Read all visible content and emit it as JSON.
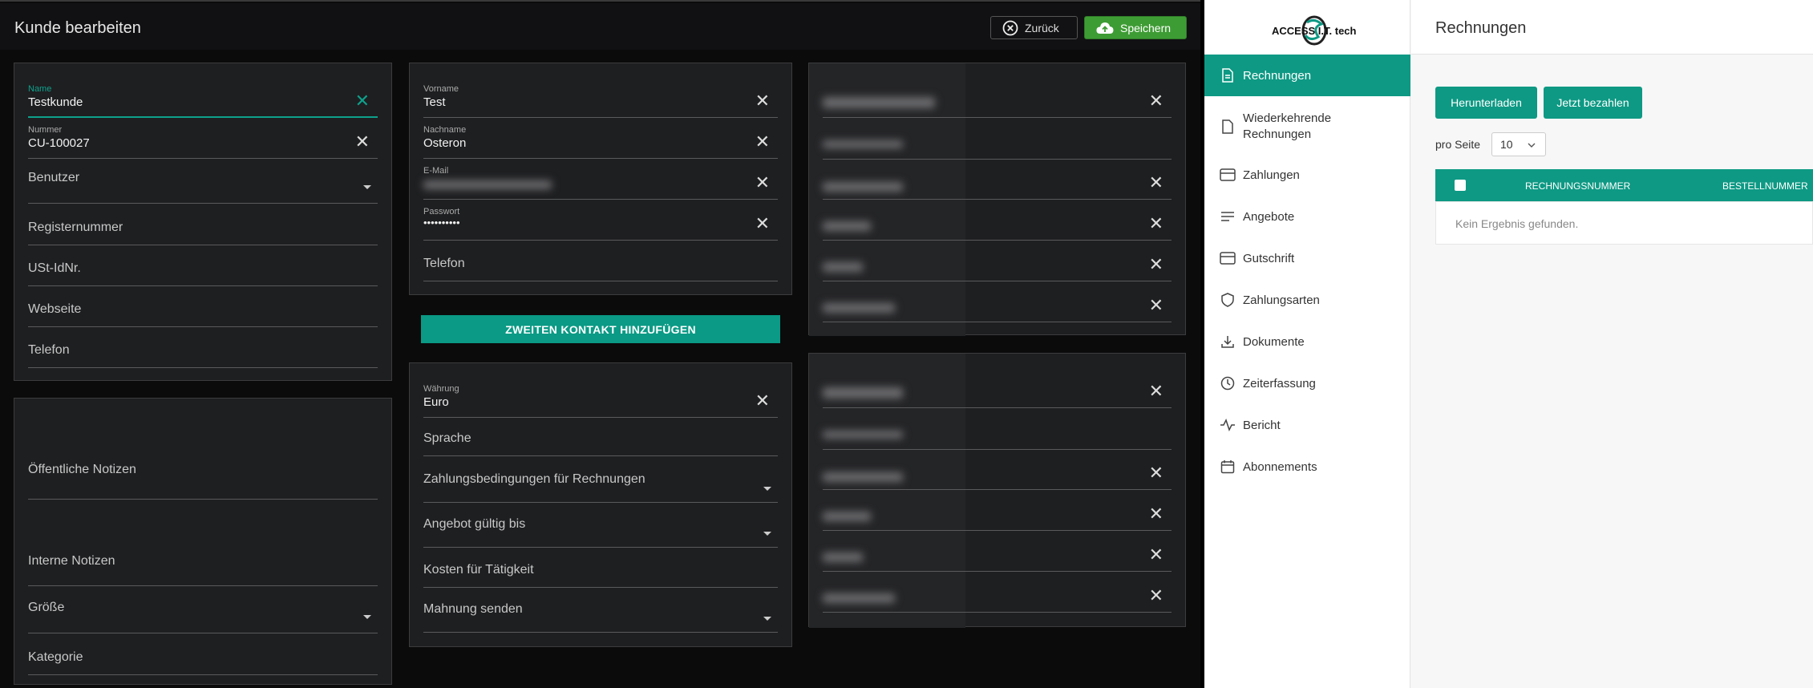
{
  "left": {
    "title": "Kunde bearbeiten",
    "back_label": "Zurück",
    "save_label": "Speichern",
    "card1": {
      "name_label": "Name",
      "name_value": "Testkunde",
      "number_label": "Nummer",
      "number_value": "CU-100027",
      "user_placeholder": "Benutzer",
      "registry_placeholder": "Registernummer",
      "vat_placeholder": "USt-IdNr.",
      "website_placeholder": "Webseite",
      "phone_placeholder": "Telefon"
    },
    "card2": {
      "public_notes": "Öffentliche Notizen",
      "internal_notes": "Interne Notizen",
      "size_placeholder": "Größe",
      "category_placeholder": "Kategorie"
    },
    "contact": {
      "firstname_label": "Vorname",
      "firstname_value": "Test",
      "lastname_label": "Nachname",
      "lastname_value": "Osteron",
      "email_label": "E-Mail",
      "password_label": "Passwort",
      "password_value": "••••••••••",
      "phone_placeholder": "Telefon",
      "add_contact_label": "ZWEITEN KONTAKT HINZUFÜGEN"
    },
    "settings": {
      "currency_label": "Währung",
      "currency_value": "Euro",
      "language_placeholder": "Sprache",
      "payment_terms_placeholder": "Zahlungsbedingungen für Rechnungen",
      "quote_valid_placeholder": "Angebot gültig bis",
      "task_cost_placeholder": "Kosten für Tätigkeit",
      "reminder_placeholder": "Mahnung senden"
    }
  },
  "right": {
    "logo_text": "ACCESS I.T. tech",
    "nav": [
      {
        "label": "Rechnungen",
        "icon": "document-icon"
      },
      {
        "label": "Wiederkehrende Rechnungen",
        "icon": "file-icon"
      },
      {
        "label": "Zahlungen",
        "icon": "credit-card-icon"
      },
      {
        "label": "Angebote",
        "icon": "align-left-icon"
      },
      {
        "label": "Gutschrift",
        "icon": "credit-card-icon"
      },
      {
        "label": "Zahlungsarten",
        "icon": "shield-icon"
      },
      {
        "label": "Dokumente",
        "icon": "download-icon"
      },
      {
        "label": "Zeiterfassung",
        "icon": "clock-icon"
      },
      {
        "label": "Bericht",
        "icon": "activity-icon"
      },
      {
        "label": "Abonnements",
        "icon": "calendar-icon"
      }
    ],
    "page_title": "Rechnungen",
    "download_label": "Herunterladen",
    "pay_now_label": "Jetzt bezahlen",
    "per_page_label": "pro Seite",
    "per_page_value": "10",
    "columns": [
      "RECHNUNGSNUMMER",
      "BESTELLNUMMER"
    ],
    "empty_message": "Kein Ergebnis gefunden.",
    "accent": "#0e9984"
  }
}
